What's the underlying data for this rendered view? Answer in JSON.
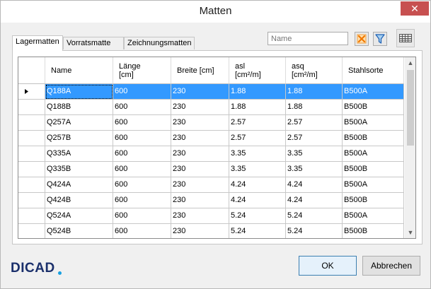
{
  "window": {
    "title": "Matten",
    "close_label": "✕"
  },
  "tabs": [
    {
      "label": "Lagermatten",
      "active": true
    },
    {
      "label": "Vorratsmatte",
      "active": false
    },
    {
      "label": "Zeichnungsmatten",
      "active": false
    }
  ],
  "search": {
    "placeholder": "Name",
    "value": ""
  },
  "toolbar": {
    "clear_icon": "clear-filter-icon",
    "filter_icon": "funnel-icon",
    "grid_icon": "grid-icon"
  },
  "table": {
    "columns": [
      {
        "label": "Name"
      },
      {
        "label": "Länge\n[cm]"
      },
      {
        "label": "Breite [cm]"
      },
      {
        "label": "asl\n[cm²/m]"
      },
      {
        "label": "asq\n[cm²/m]"
      },
      {
        "label": "Stahlsorte"
      }
    ],
    "selected_row": 0,
    "rows": [
      [
        "Q188A",
        "600",
        "230",
        "1.88",
        "1.88",
        "B500A"
      ],
      [
        "Q188B",
        "600",
        "230",
        "1.88",
        "1.88",
        "B500B"
      ],
      [
        "Q257A",
        "600",
        "230",
        "2.57",
        "2.57",
        "B500A"
      ],
      [
        "Q257B",
        "600",
        "230",
        "2.57",
        "2.57",
        "B500B"
      ],
      [
        "Q335A",
        "600",
        "230",
        "3.35",
        "3.35",
        "B500A"
      ],
      [
        "Q335B",
        "600",
        "230",
        "3.35",
        "3.35",
        "B500B"
      ],
      [
        "Q424A",
        "600",
        "230",
        "4.24",
        "4.24",
        "B500A"
      ],
      [
        "Q424B",
        "600",
        "230",
        "4.24",
        "4.24",
        "B500B"
      ],
      [
        "Q524A",
        "600",
        "230",
        "5.24",
        "5.24",
        "B500A"
      ],
      [
        "Q524B",
        "600",
        "230",
        "5.24",
        "5.24",
        "B500B"
      ]
    ]
  },
  "footer": {
    "logo": "DICAD",
    "ok_label": "OK",
    "cancel_label": "Abbrechen"
  },
  "colors": {
    "selection": "#3399ff",
    "close": "#c75050",
    "logo": "#1a2f6b",
    "clear_icon": "#f07800",
    "filter_icon": "#1a5fb4"
  }
}
